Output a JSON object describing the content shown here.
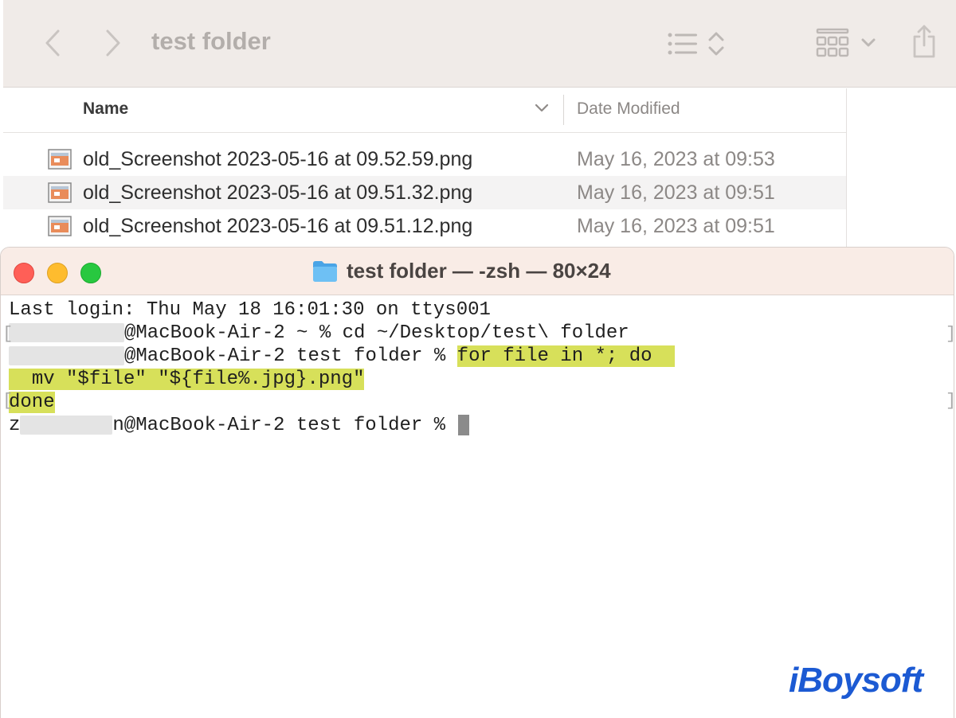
{
  "finder": {
    "title": "test folder",
    "columns": {
      "name": "Name",
      "date_modified": "Date Modified"
    },
    "files": [
      {
        "name": "old_Screenshot 2023-05-16 at 09.52.59.png",
        "date": "May 16, 2023 at 09:53"
      },
      {
        "name": "old_Screenshot 2023-05-16 at 09.51.32.png",
        "date": "May 16, 2023 at 09:51"
      },
      {
        "name": "old_Screenshot 2023-05-16 at 09.51.12.png",
        "date": "May 16, 2023 at 09:51"
      }
    ],
    "icons": [
      "back-chevron-icon",
      "forward-chevron-icon",
      "list-view-icon",
      "sort-updown-icon",
      "grid-view-icon",
      "chevron-down-icon",
      "share-icon",
      "image-file-icon"
    ]
  },
  "terminal": {
    "title": "test folder — -zsh — 80×24",
    "lines": {
      "l1": "Last login: Thu May 18 16:01:30 on ttys001",
      "l2_suffix": "@MacBook-Air-2 ~ % cd ~/Desktop/test\\ folder",
      "l3_suffix": "@MacBook-Air-2 test folder % ",
      "l3_cmd": "for file in *; do",
      "l4_cmd": "mv \"$file\" \"${file%.jpg}.png\"",
      "l5_cmd": "done",
      "l6_prefix": "z",
      "l6_suffix": "n@MacBook-Air-2 test folder % "
    },
    "colors": {
      "highlight": "#d7e05a",
      "close": "#ff5f57",
      "minimize": "#febc2e",
      "zoom": "#28c840"
    }
  },
  "watermark": {
    "brand": "iBoysoft",
    "color": "#1c5ad3"
  }
}
